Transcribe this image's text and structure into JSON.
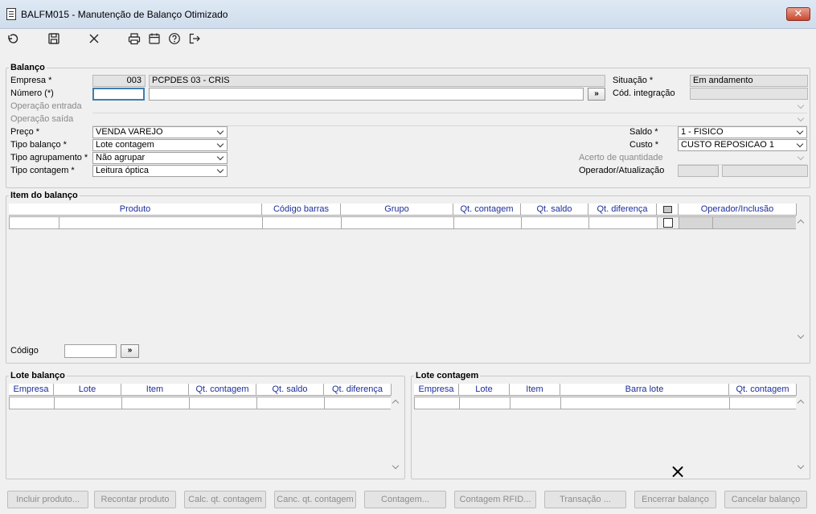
{
  "window": {
    "title": "BALFM015 - Manutenção de Balanço Otimizado",
    "close_label": "✕"
  },
  "toolbar": {
    "icons": [
      "undo-icon",
      "save-icon",
      "cancel-icon",
      "print-icon",
      "calendar-icon",
      "help-icon",
      "exit-icon"
    ]
  },
  "balanco": {
    "title": "Balanço",
    "empresa_label": "Empresa *",
    "empresa_code": "003",
    "empresa_name": "PCPDES 03 - CRIS",
    "numero_label": "Número (*)",
    "numero_value": "",
    "numero_desc": "",
    "numero_btn": "»",
    "operacao_entrada_label": "Operação entrada",
    "operacao_saida_label": "Operação saída",
    "preco_label": "Preço *",
    "preco_value": "VENDA VAREJO",
    "tipo_balanco_label": "Tipo balanço *",
    "tipo_balanco_value": "Lote contagem",
    "tipo_agrupamento_label": "Tipo agrupamento *",
    "tipo_agrupamento_value": "Não agrupar",
    "tipo_contagem_label": "Tipo contagem *",
    "tipo_contagem_value": "Leitura óptica",
    "situacao_label": "Situação *",
    "situacao_value": "Em andamento",
    "cod_integracao_label": "Cód. integração",
    "cod_integracao_value": "",
    "saldo_label": "Saldo *",
    "saldo_value": "1 - FISICO",
    "custo_label": "Custo *",
    "custo_value": "CUSTO REPOSICAO 1",
    "acerto_label": "Acerto de quantidade",
    "operador_label": "Operador/Atualização"
  },
  "item_balanco": {
    "title": "Item do balanço",
    "columns": [
      "Produto",
      "Código barras",
      "Grupo",
      "Qt. contagem",
      "Qt. saldo",
      "Qt. diferença",
      "",
      "Operador/Inclusão"
    ],
    "codigo_label": "Código",
    "codigo_btn": "»"
  },
  "lote_balanco": {
    "title": "Lote balanço",
    "columns": [
      "Empresa",
      "Lote",
      "Item",
      "Qt. contagem",
      "Qt. saldo",
      "Qt. diferença"
    ]
  },
  "lote_contagem": {
    "title": "Lote contagem",
    "columns": [
      "Empresa",
      "Lote",
      "Item",
      "Barra lote",
      "Qt. contagem"
    ]
  },
  "actions": [
    "Incluir produto...",
    "Recontar produto",
    "Calc. qt. contagem",
    "Canc. qt. contagem",
    "Contagem...",
    "Contagem RFID...",
    "Transação ...",
    "Encerrar balanço",
    "Cancelar balanço"
  ],
  "cursor": "×"
}
